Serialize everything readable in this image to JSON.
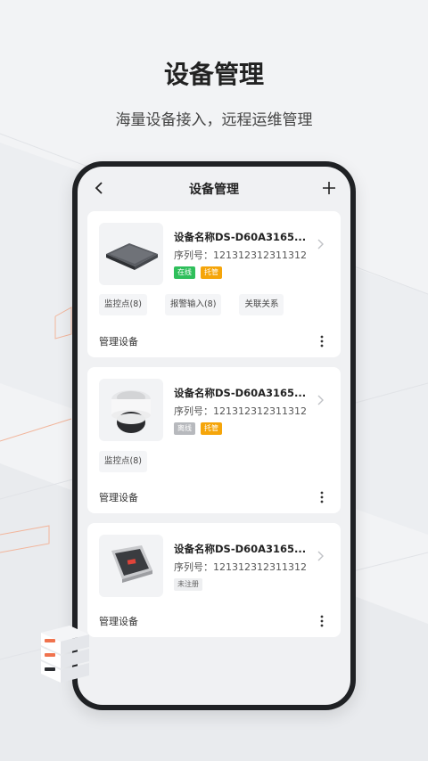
{
  "hero": {
    "title": "设备管理",
    "subtitle": "海量设备接入，远程运维管理"
  },
  "navbar": {
    "title": "设备管理",
    "back_icon": "chevron-left-icon",
    "add_icon": "plus-icon"
  },
  "colors": {
    "online": "#2fbf5b",
    "warning": "#f5a50a",
    "offline": "#b7b9bd"
  },
  "devices": [
    {
      "name": "设备名称DS-D60A3165...",
      "serial": "序列号：121312312311312",
      "status": "在线",
      "badge": "托管",
      "chips": [
        "监控点(8)",
        "报警输入(8)",
        "关联关系"
      ],
      "footer": "管理设备",
      "image": "nvr-recorder-icon"
    },
    {
      "name": "设备名称DS-D60A3165...",
      "serial": "序列号：121312312311312",
      "status": "离线",
      "badge": "托管",
      "chips": [
        "监控点(8)"
      ],
      "footer": "管理设备",
      "image": "dome-camera-icon"
    },
    {
      "name": "设备名称DS-D60A3165...",
      "serial": "序列号：121312312311312",
      "status": "未注册",
      "chips": [],
      "footer": "管理设备",
      "image": "access-control-panel-icon"
    }
  ]
}
